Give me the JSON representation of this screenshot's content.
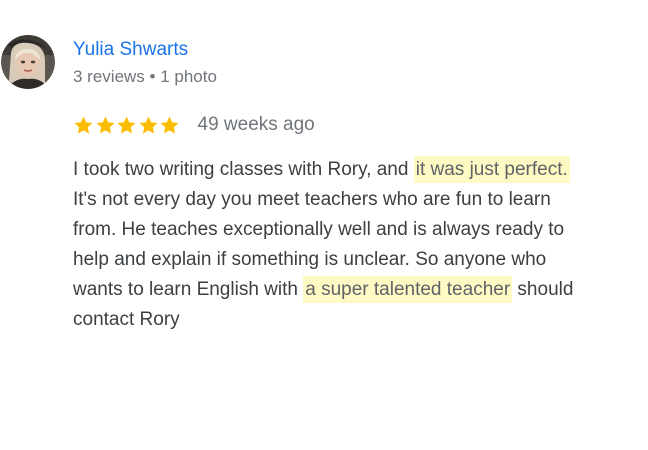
{
  "review": {
    "author": {
      "name": "Yulia Shwarts",
      "meta": "3 reviews • 1 photo"
    },
    "rating": 5,
    "rating_max": 5,
    "date": "49 weeks ago",
    "highlight_color": "#fff9c4",
    "star_color": "#fbbc04",
    "name_color": "#1a73e8",
    "text": {
      "l1_a": "I took two writing classes with Rory, and ",
      "l1_hl": "it was just perfect.",
      "l2": "It's not every day you meet teachers who are fun to learn",
      "l3": "from. He teaches exceptionally well and is always ready to",
      "l4": "help and explain if something is unclear. So anyone who",
      "l5_a": "wants to learn English with ",
      "l5_hl": "a super talented teacher",
      "l5_b": " should",
      "l6": "contact Rory"
    }
  }
}
